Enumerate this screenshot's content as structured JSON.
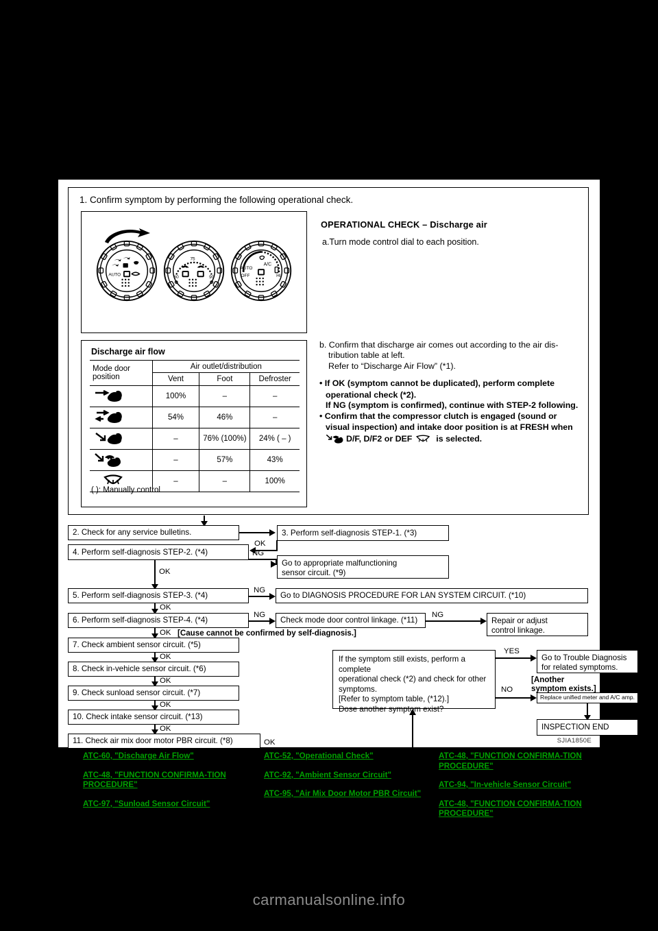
{
  "page": {
    "caption": "SJIA1850E",
    "footer": "carmanualsonline.info"
  },
  "step1": {
    "title": "1. Confirm symptom by performing the following operational check.",
    "operational_check_heading": "OPERATIONAL CHECK – Discharge air",
    "step_a": "a.Turn mode control dial to each position.",
    "step_b_line1": "b. Confirm that discharge air comes out according to the air dis-",
    "step_b_line2": "tribution table at left.",
    "step_b_line3": "Refer to “Discharge Air Flow” (*1).",
    "bullet1_line1": "If OK (symptom cannot be duplicated), perform complete",
    "bullet1_line2": "operational check (*2).",
    "bullet1_line3": "If NG (symptom is confirmed), continue with STEP-2 following.",
    "bullet2_line1": "Confirm that the compressor clutch is engaged (sound or",
    "bullet2_line2": "visual inspection) and intake door position is at FRESH when",
    "bullet2_line3_a": "D/F, D/F2 or DEF",
    "bullet2_line3_b": "is selected."
  },
  "table": {
    "title": "Discharge air flow",
    "mode_header_line1": "Mode door",
    "mode_header_line2": "position",
    "group_header": "Air outlet/distribution",
    "columns": [
      "Vent",
      "Foot",
      "Defroster"
    ],
    "rows": [
      {
        "mode": "vent-icon",
        "vent": "100%",
        "foot": "–",
        "defroster": "–"
      },
      {
        "mode": "bilevel-icon",
        "vent": "54%",
        "foot": "46%",
        "defroster": "–"
      },
      {
        "mode": "foot-icon",
        "vent": "–",
        "foot": "76% (100%)",
        "defroster": "24% (  –  )"
      },
      {
        "mode": "foot-defrost-icon",
        "vent": "–",
        "foot": "57%",
        "defroster": "43%"
      },
      {
        "mode": "defrost-icon",
        "vent": "–",
        "foot": "–",
        "defroster": "100%"
      }
    ],
    "note": "(    ): Manually control"
  },
  "flow": {
    "boxes": {
      "b2": "2. Check for any service bulletins.",
      "b3": "3. Perform self-diagnosis STEP-1. (*3)",
      "b4": "4. Perform self-diagnosis STEP-2. (*4)",
      "b_sensor_l1": "Go to appropriate malfunctioning",
      "b_sensor_l2": "sensor circuit. (*9)",
      "b5": "5. Perform self-diagnosis STEP-3. (*4)",
      "b_lan": "Go to DIAGNOSIS PROCEDURE FOR LAN SYSTEM CIRCUIT. (*10)",
      "b6": "6. Perform self-diagnosis STEP-4. (*4)",
      "b_linkage": "Check mode door control linkage. (*11)",
      "b_repair_l1": "Repair or adjust",
      "b_repair_l2": "control linkage.",
      "b7": "7. Check ambient sensor circuit. (*5)",
      "b8": "8. Check in-vehicle sensor circuit. (*6)",
      "b9": "9. Check sunload sensor circuit. (*7)",
      "b10": "10. Check intake sensor circuit. (*13)",
      "b11": "11. Check air mix door motor PBR circuit. (*8)",
      "b_symptom_l1": "If the symptom still exists, perform a complete",
      "b_symptom_l2": "operational check (*2) and check for other",
      "b_symptom_l3": "symptoms.",
      "b_symptom_l4": "[Refer to symptom table, (*12).]",
      "b_symptom_l5": "Dose another symptom exist?",
      "b_trouble_l1": "Go to Trouble Diagnosis",
      "b_trouble_l2": "for related symptoms.",
      "b_replace": "Replace unified meter and A/C amp.",
      "b_end": "INSPECTION END"
    },
    "labels": {
      "ok": "OK",
      "ng": "NG",
      "yes": "YES",
      "no": "NO",
      "cause_note": "[Cause cannot be confirmed by self-diagnosis.]",
      "another_symptom": "[Another symptom exists.]"
    }
  },
  "links": {
    "accent": "#00A000",
    "column1": [
      "ATC-60, \"Discharge Air Flow\"",
      "ATC-48, \"FUNCTION CONFIRMA-TION PROCEDURE\"",
      "ATC-97, \"Sunload Sensor Circuit\""
    ],
    "column2": [
      "ATC-52, \"Operational Check\"",
      "ATC-92, \"Ambient Sensor Circuit\"",
      "ATC-95, \"Air Mix Door Motor PBR Circuit\""
    ],
    "column3": [
      "ATC-48, \"FUNCTION CONFIRMA-TION PROCEDURE\"",
      "ATC-94, \"In-vehicle Sensor Circuit\"",
      "ATC-48, \"FUNCTION CONFIRMA-TION PROCEDURE\""
    ]
  }
}
